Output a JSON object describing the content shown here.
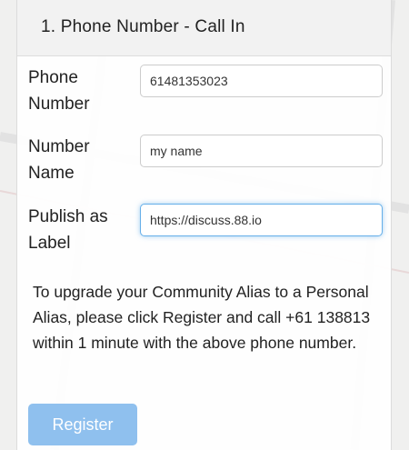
{
  "form": {
    "title": "1. Phone Number - Call In",
    "phone": {
      "label_line1": "Phone",
      "label_line2": "Number",
      "value": "61481353023"
    },
    "name": {
      "label_line1": "Number",
      "label_line2": "Name",
      "value": "my name"
    },
    "publish": {
      "label_line1": "Publish as",
      "label_line2": "Label",
      "value": "https://discuss.88.io"
    },
    "info": "To upgrade your Community Alias to a Personal Alias, please click Register and call +61 138813 within 1 minute with the above phone number.",
    "register_label": "Register"
  },
  "colors": {
    "accent": "#66afe9",
    "button": "#8fc0ee"
  }
}
